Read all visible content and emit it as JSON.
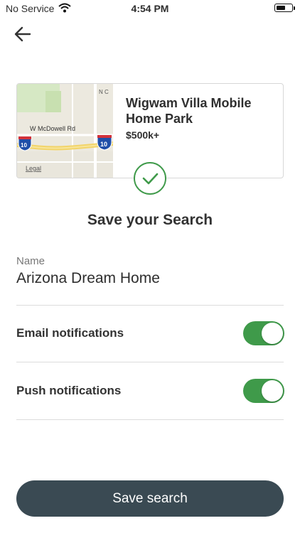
{
  "status_bar": {
    "carrier": "No Service",
    "time": "4:54 PM"
  },
  "header": {
    "back_icon": "arrow-left-icon"
  },
  "listing_card": {
    "title": "Wigwam Villa Mobile Home Park",
    "price": "$500k+",
    "map": {
      "road_label": "W McDowell Rd",
      "shield_label": "10",
      "street_letters": "N C",
      "legal_label": "Legal"
    }
  },
  "confirmation_icon": "check-circle-icon",
  "page_title": "Save your Search",
  "form": {
    "name_label": "Name",
    "name_value": "Arizona Dream Home",
    "email_notifications_label": "Email notifications",
    "email_notifications_on": true,
    "push_notifications_label": "Push notifications",
    "push_notifications_on": true
  },
  "save_button_label": "Save search",
  "colors": {
    "accent_green": "#3f9a4a",
    "button_dark": "#3a4a53"
  }
}
